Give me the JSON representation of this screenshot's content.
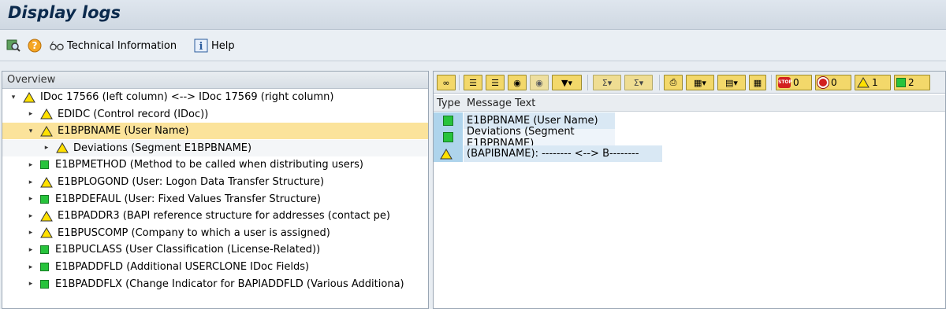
{
  "window": {
    "title": "Display logs"
  },
  "toolbar": {
    "items": [
      {
        "icon": "search-log-icon",
        "label": ""
      },
      {
        "icon": "help-circle-icon",
        "label": ""
      },
      {
        "icon": "glasses-icon",
        "label": "Technical Information"
      },
      {
        "icon": "info-icon",
        "label": "Help"
      }
    ]
  },
  "overview": {
    "header": "Overview",
    "tree": [
      {
        "label": "IDoc 17566 (left column) <--> IDoc 17569 (right column)",
        "status": "warning",
        "level": 0,
        "expanded": true
      },
      {
        "label": "EDIDC (Control record (IDoc))",
        "status": "warning",
        "level": 1,
        "expanded": false
      },
      {
        "label": "E1BPBNAME (User Name)",
        "status": "warning",
        "level": 1,
        "expanded": true,
        "selected": true
      },
      {
        "label": "Deviations (Segment E1BPBNAME)",
        "status": "warning",
        "level": 2,
        "expanded": false
      },
      {
        "label": "E1BPMETHOD (Method to be called when distributing users)",
        "status": "success",
        "level": 1,
        "expanded": false
      },
      {
        "label": "E1BPLOGOND (User: Logon Data Transfer Structure)",
        "status": "warning",
        "level": 1,
        "expanded": false
      },
      {
        "label": "E1BPDEFAUL (User: Fixed Values Transfer Structure)",
        "status": "success",
        "level": 1,
        "expanded": false
      },
      {
        "label": "E1BPADDR3 (BAPI reference structure for addresses (contact pe)",
        "status": "warning",
        "level": 1,
        "expanded": false
      },
      {
        "label": "E1BPUSCOMP (Company to which a user is assigned)",
        "status": "warning",
        "level": 1,
        "expanded": false
      },
      {
        "label": "E1BPUCLASS (User Classification (License-Related))",
        "status": "success",
        "level": 1,
        "expanded": false
      },
      {
        "label": "E1BPADDFLD (Additional USERCLONE IDoc Fields)",
        "status": "success",
        "level": 1,
        "expanded": false
      },
      {
        "label": "E1BPADDFLX (Change Indicator for BAPIADDFLD (Various Additiona)",
        "status": "success",
        "level": 1,
        "expanded": false
      }
    ]
  },
  "messages": {
    "counters": {
      "error": "0",
      "abort": "0",
      "warning": "1",
      "success": "2"
    },
    "columns": {
      "type": "Type",
      "message": "Message Text"
    },
    "rows": [
      {
        "type": "success",
        "text": "E1BPBNAME (User Name)"
      },
      {
        "type": "success",
        "text": "Deviations (Segment E1BPBNAME)"
      },
      {
        "type": "warning",
        "text": "(BAPIBNAME): -------- <--> B--------"
      }
    ]
  },
  "colors": {
    "success": "#27c33c",
    "warning": "#ffe000",
    "selected": "#fbe39b",
    "error": "#d21f1f"
  }
}
